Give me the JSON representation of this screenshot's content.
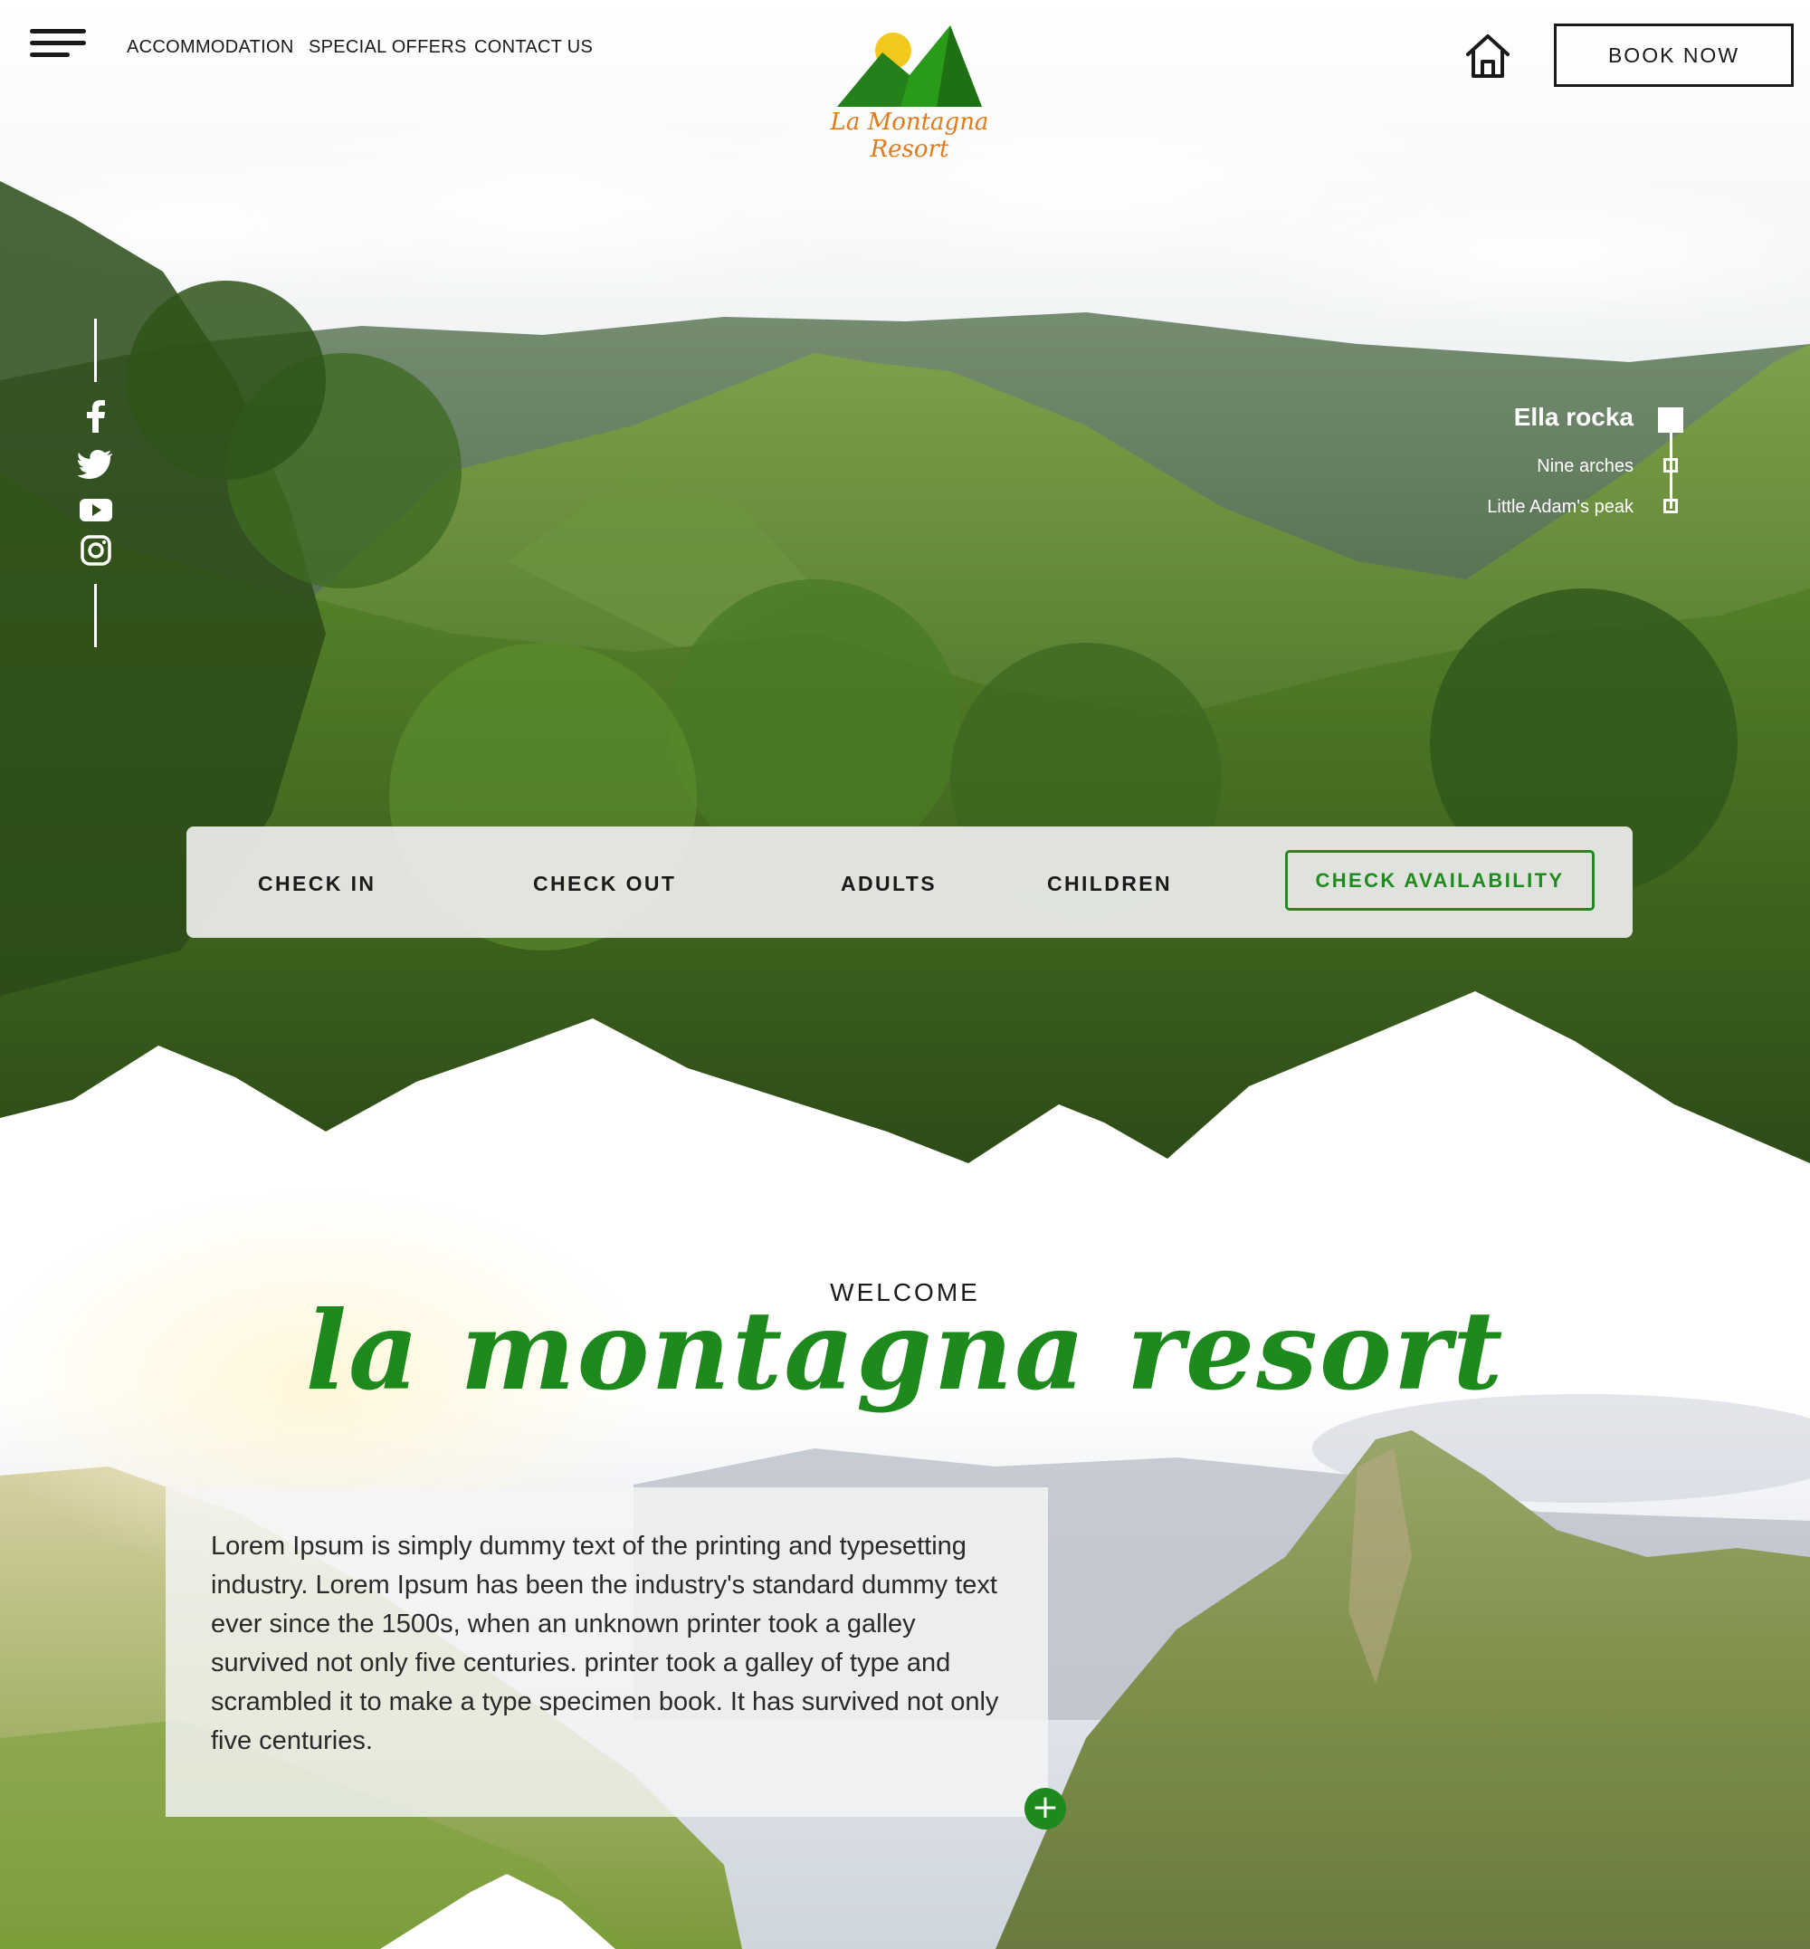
{
  "header": {
    "menu_icon": "hamburger-menu-icon",
    "nav": [
      "ACCOMMODATION",
      "SPECIAL OFFERS",
      "CONTACT US"
    ],
    "logo_text": "La Montagna Resort",
    "home_icon": "home-icon",
    "book_now": "BOOK NOW"
  },
  "social": [
    "facebook-icon",
    "twitter-icon",
    "youtube-icon",
    "instagram-icon"
  ],
  "slider": {
    "items": [
      "Ella rocka",
      "Nine arches",
      "Little Adam's peak"
    ],
    "active_index": 0
  },
  "booking": {
    "check_in": "CHECK IN",
    "check_out": "CHECK OUT",
    "adults": "ADULTS",
    "children": "CHILDREN",
    "button": "CHECK AVAILABILITY"
  },
  "welcome": {
    "kicker": "WELCOME",
    "title": "la montagna resort",
    "body": "Lorem Ipsum is simply dummy text of the printing and typesetting industry. Lorem Ipsum has been the industry's standard dummy text ever since the 1500s, when an unknown printer took a galley survived not only five centuries. printer took a galley of type and scrambled it to make a type specimen book. It has survived not only five centuries.",
    "more_icon": "plus-icon"
  },
  "colors": {
    "brand_green": "#1e8a1e",
    "logo_orange": "#e07a1b",
    "logo_sun": "#f2c81c",
    "text_dark": "#1a1a1a"
  }
}
